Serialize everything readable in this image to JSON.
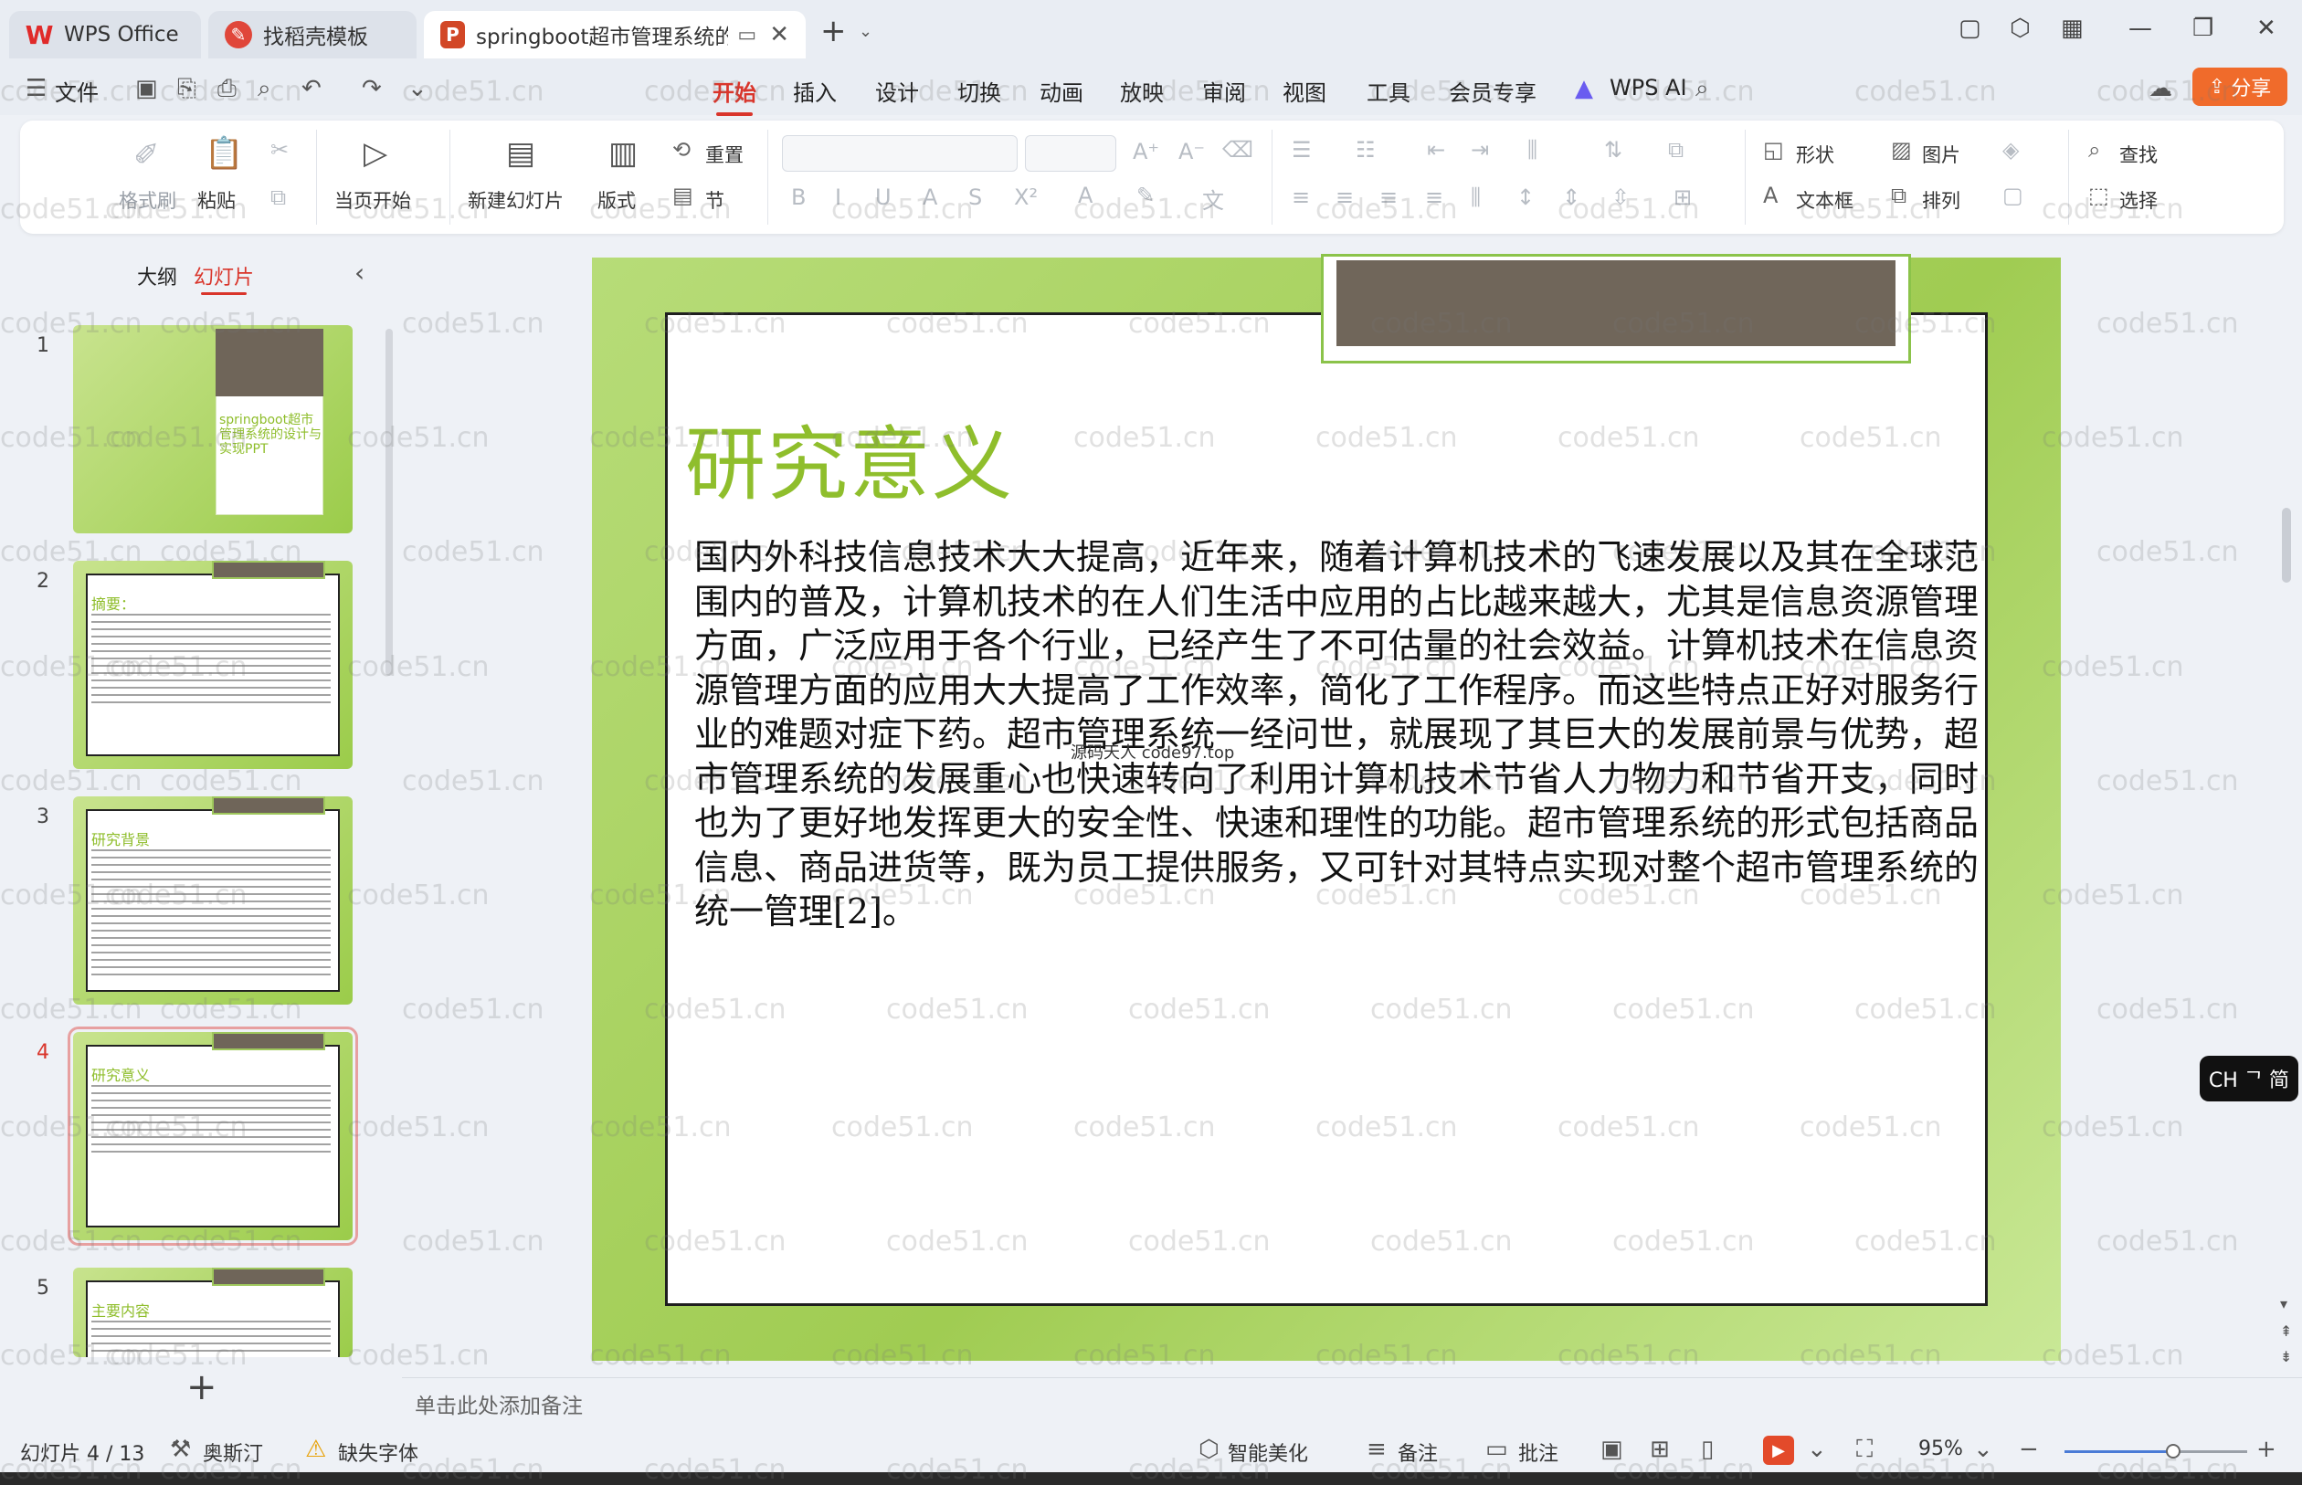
{
  "tabs": [
    {
      "label": "WPS Office"
    },
    {
      "label": "找稻壳模板"
    },
    {
      "label": "springboot超市管理系统的设"
    }
  ],
  "menu": {
    "file": "文件",
    "items": [
      "开始",
      "插入",
      "设计",
      "切换",
      "动画",
      "放映",
      "审阅",
      "视图",
      "工具",
      "会员专享",
      "WPS AI"
    ],
    "active": "开始",
    "share": "分享"
  },
  "ribbon": {
    "format_painter": "格式刷",
    "paste": "粘贴",
    "from_current": "当页开始",
    "new_slide": "新建幻灯片",
    "layout": "版式",
    "reset": "重置",
    "section": "节",
    "shape": "形状",
    "picture": "图片",
    "find": "查找",
    "textbox": "文本框",
    "arrange": "排列",
    "select": "选择"
  },
  "panel": {
    "outline_tab": "大纲",
    "slides_tab": "幻灯片",
    "thumbnails": [
      {
        "num": "1",
        "title": "springboot超市管理系统的设计与实现PPT"
      },
      {
        "num": "2",
        "title": "摘要："
      },
      {
        "num": "3",
        "title": "研究背景"
      },
      {
        "num": "4",
        "title": "研究意义"
      },
      {
        "num": "5",
        "title": "主要内容"
      }
    ],
    "current_index": 4
  },
  "slide": {
    "title": "研究意义",
    "body": "国内外科技信息技术大大提高，近年来，随着计算机技术的飞速发展以及其在全球范围内的普及，计算机技术的在人们生活中应用的占比越来越大，尤其是信息资源管理方面，广泛应用于各个行业，已经产生了不可估量的社会效益。计算机技术在信息资源管理方面的应用大大提高了工作效率，简化了工作程序。而这些特点正好对服务行业的难题对症下药。超市管理系统一经问世，就展现了其巨大的发展前景与优势，超市管理系统的发展重心也快速转向了利用计算机技术节省人力物力和节省开支，同时也为了更好地发挥更大的安全性、快速和理性的功能。超市管理系统的形式包括商品信息、商品进货等，既为员工提供服务，又可针对其特点实现对整个超市管理系统的统一管理[2]。",
    "mid_watermark": "源码天人 code97.top"
  },
  "notes_placeholder": "单击此处添加备注",
  "ime": "CH ᄀ 简",
  "status": {
    "slide_counter": "幻灯片 4 / 13",
    "theme": "奥斯汀",
    "missing_font": "缺失字体",
    "beautify": "智能美化",
    "notes": "备注",
    "comment": "批注",
    "zoom": "95%",
    "zoom_fraction": 0.95
  },
  "watermark_text": "code51.cn",
  "colors": {
    "accent": "#d9352b",
    "title_green": "#8fbe2c",
    "share": "#f06b2b"
  }
}
